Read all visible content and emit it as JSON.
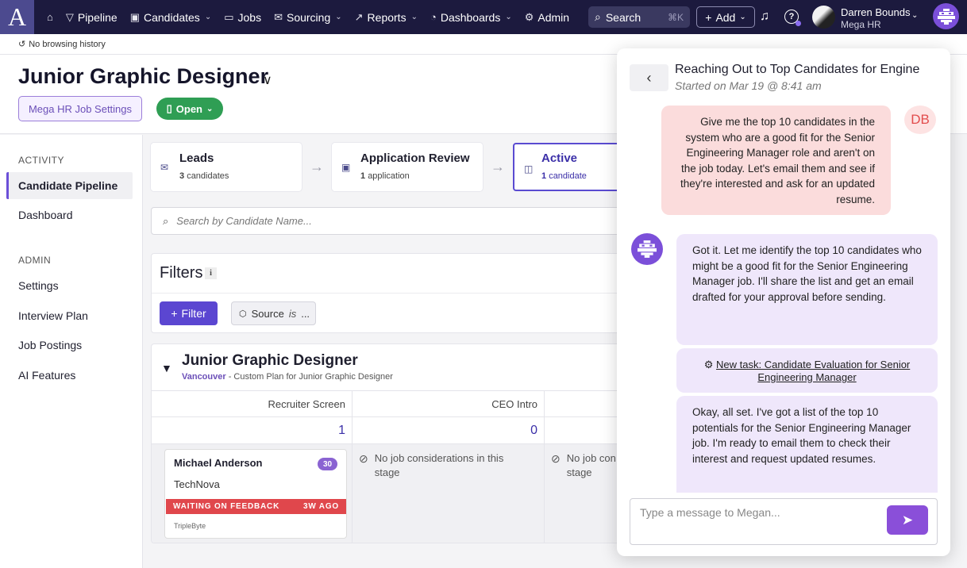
{
  "nav": {
    "logo": "A",
    "items": [
      {
        "label": "Pipeline",
        "icon": "filter-icon"
      },
      {
        "label": "Candidates",
        "icon": "person-card-icon"
      },
      {
        "label": "Jobs",
        "icon": "briefcase-icon"
      },
      {
        "label": "Sourcing",
        "icon": "inbox-icon"
      },
      {
        "label": "Reports",
        "icon": "chart-icon"
      },
      {
        "label": "Dashboards",
        "icon": "gauge-icon"
      },
      {
        "label": "Admin",
        "icon": "gear-icon"
      }
    ],
    "search_label": "Search",
    "search_shortcut": "⌘K",
    "add_label": "Add",
    "user_name": "Darren Bounds",
    "user_org": "Mega HR"
  },
  "subbar": {
    "history": "No browsing history"
  },
  "header": {
    "title": "Junior Graphic Designer",
    "settings_button": "Mega HR Job Settings",
    "status_button": "Open"
  },
  "sidebar": {
    "activity_heading": "ACTIVITY",
    "activity_items": [
      "Candidate Pipeline",
      "Dashboard"
    ],
    "admin_heading": "ADMIN",
    "admin_items": [
      "Settings",
      "Interview Plan",
      "Job Postings",
      "AI Features"
    ]
  },
  "stages": [
    {
      "name": "Leads",
      "count": "3",
      "unit": "candidates"
    },
    {
      "name": "Application Review",
      "count": "1",
      "unit": "application"
    },
    {
      "name": "Active",
      "count": "1",
      "unit": "candidate"
    }
  ],
  "candidate_search": {
    "placeholder": "Search by Candidate Name..."
  },
  "filters": {
    "title": "Filters",
    "info": "i",
    "filter_button": "Filter",
    "chip_field": "Source",
    "chip_op": "is",
    "chip_value": "..."
  },
  "plan": {
    "title": "Junior Graphic Designer",
    "location": "Vancouver",
    "subtitle": " - Custom Plan for Junior Graphic Designer",
    "columns": [
      {
        "name": "Recruiter Screen",
        "count": "1"
      },
      {
        "name": "CEO Intro",
        "count": "0"
      }
    ],
    "empty_message": "No job considerations in this stage",
    "empty_message_cut": "No job con",
    "empty_message_cut2": "stage"
  },
  "candidate_card": {
    "name": "Michael Anderson",
    "score": "30",
    "company": "TechNova",
    "status": "WAITING ON FEEDBACK",
    "age": "3W AGO",
    "source": "TripleByte"
  },
  "chat": {
    "title": "Reaching Out to Top Candidates for Engine",
    "started": "Started on Mar 19 @ 8:41 am",
    "user_initials": "DB",
    "messages": [
      "Give me the top 10 candidates in the system who are a good fit for the Senior Engineering Manager role and aren't on the job today. Let's email them and see if they're interested and ask for an updated resume.",
      "Got it. Let me identify the top 10 candidates who might be a good fit for the Senior Engineering Manager job. I'll share the list and get an email drafted for your approval before sending.",
      "New task: Candidate Evaluation for Senior Engineering Manager",
      "Okay, all set. I've got a list of the top 10 potentials for the Senior Engineering Manager job. I'm ready to email them to check their interest and request updated resumes."
    ],
    "input_placeholder": "Type a message to Megan..."
  },
  "colors": {
    "nav_bg": "#1c1a3e",
    "accent": "#5b46d1",
    "open_green": "#2f9e54",
    "status_red": "#e0474c",
    "user_bubble": "#fbdcdc",
    "bot_bubble": "#efe7fb"
  }
}
